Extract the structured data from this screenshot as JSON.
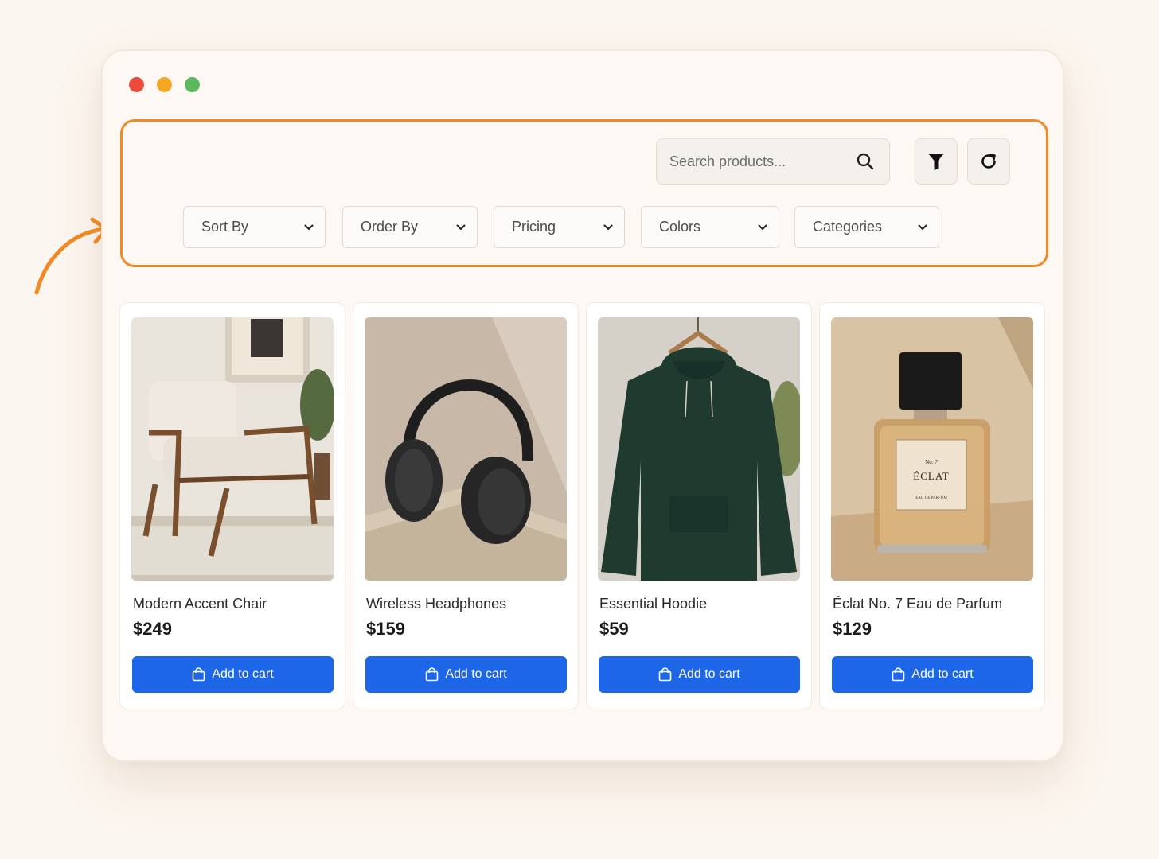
{
  "colors": {
    "page_bg": "#fcf6f0",
    "accent_orange": "#f28a24",
    "button_blue": "#1e66e8",
    "traffic_red": "#ec4a3a",
    "traffic_yellow": "#f5a623",
    "traffic_green": "#5cb85c"
  },
  "toolbar": {
    "search": {
      "placeholder": "Search products...",
      "value": "",
      "icon": "search-icon"
    },
    "filter_icon": "filter-icon",
    "refresh_icon": "refresh-icon"
  },
  "filters": [
    {
      "label": "Sort By",
      "icon": "chevron-down-icon"
    },
    {
      "label": "Order By",
      "icon": "chevron-down-icon"
    },
    {
      "label": "Pricing",
      "icon": "chevron-down-icon"
    },
    {
      "label": "Colors",
      "icon": "chevron-down-icon"
    },
    {
      "label": "Categories",
      "icon": "chevron-down-icon"
    }
  ],
  "products": [
    {
      "name": "Modern Accent Chair",
      "price": "$249",
      "button": "Add to cart",
      "image": "armchair-photo"
    },
    {
      "name": "Wireless Headphones",
      "price": "$159",
      "button": "Add to cart",
      "image": "headphones-photo"
    },
    {
      "name": "Essential Hoodie",
      "price": "$59",
      "button": "Add to cart",
      "image": "hoodie-photo"
    },
    {
      "name": "Éclat No. 7 Eau de Parfum",
      "price": "$129",
      "button": "Add to cart",
      "image": "perfume-photo",
      "label": {
        "line1": "No. 7",
        "line2": "ÉCLAT",
        "line3": "EAU DE PARFUM"
      }
    }
  ]
}
